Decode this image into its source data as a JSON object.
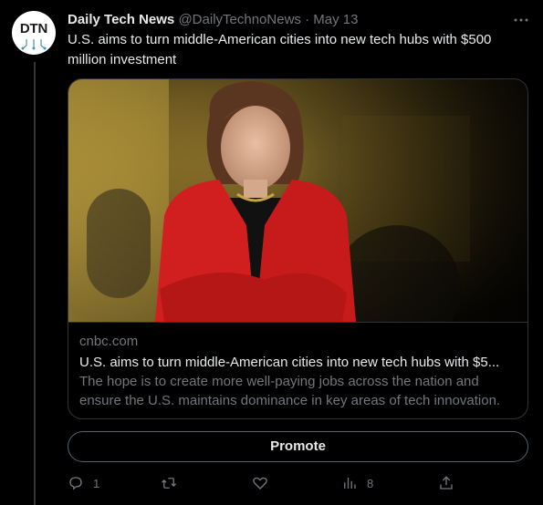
{
  "author": {
    "avatar_text": "DTN",
    "name": "Daily Tech News",
    "handle": "@DailyTechnoNews",
    "separator": "·",
    "date": "May 13"
  },
  "tweet": {
    "text": "U.S. aims to turn middle-American cities into new tech hubs with $500 million investment"
  },
  "card": {
    "domain": "cnbc.com",
    "title": "U.S. aims to turn middle-American cities into new tech hubs with $5...",
    "description": "The hope is to create more well-paying jobs across the nation and ensure the U.S. maintains dominance in key areas of tech innovation."
  },
  "promote_label": "Promote",
  "actions": {
    "reply_count": "1",
    "retweet_count": "",
    "like_count": "",
    "views_count": "8"
  },
  "icons": [
    "more-icon",
    "reply-icon",
    "retweet-icon",
    "like-icon",
    "views-icon",
    "share-icon"
  ],
  "colors": {
    "background": "#000000",
    "text": "#e7e9ea",
    "muted": "#71767b",
    "border": "#2f3336"
  }
}
